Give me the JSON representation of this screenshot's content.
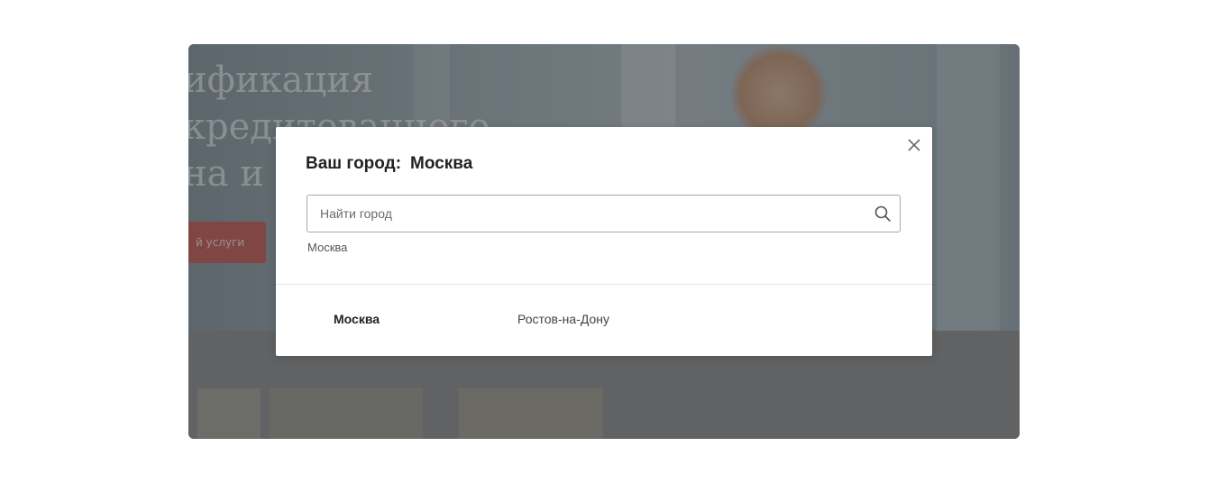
{
  "modal": {
    "title_label": "Ваш город:",
    "title_city": "Москва",
    "search": {
      "placeholder": "Найти город",
      "value": ""
    },
    "hint": "Москва",
    "cities": [
      {
        "name": "Москва",
        "active": true
      },
      {
        "name": "Ростов-на-Дону",
        "active": false
      }
    ]
  },
  "background": {
    "headline": "ификация\nкредитованного\nна и л",
    "cta": "й услуги"
  },
  "icons": {
    "close": "close-icon",
    "search": "search-icon"
  },
  "colors": {
    "overlay": "#3a3a3a",
    "accent": "#b55a55",
    "text": "#222222"
  }
}
